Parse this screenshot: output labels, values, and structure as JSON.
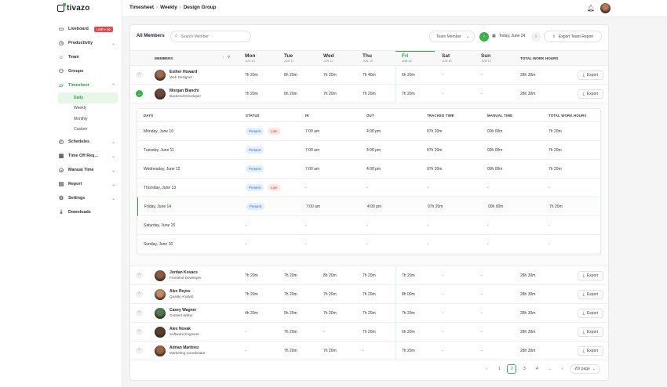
{
  "app": {
    "name": "tivazo"
  },
  "breadcrumb": [
    "Timesheet",
    "Weekly",
    "Design Group"
  ],
  "sidebar": {
    "items": [
      {
        "label": "Liveboard",
        "badge": "LIVE + 20",
        "icon": "folder-icon"
      },
      {
        "label": "Productivity",
        "icon": "stopwatch-icon",
        "chevron": true
      },
      {
        "label": "Team",
        "icon": "users-icon"
      },
      {
        "label": "Groups",
        "icon": "group-icon"
      },
      {
        "label": "Timesheet",
        "icon": "folder-open-icon",
        "chevron": true,
        "active": true
      },
      {
        "label": "Schedules",
        "icon": "clock-icon",
        "chevron": true
      },
      {
        "label": "Time Off Req...",
        "icon": "calendar-icon",
        "chevron": true
      },
      {
        "label": "Manual Time",
        "icon": "clock-edit-icon",
        "chevron": true
      },
      {
        "label": "Report",
        "icon": "report-icon",
        "chevron": true
      },
      {
        "label": "Settings",
        "icon": "gear-icon",
        "chevron": true
      },
      {
        "label": "Downloads",
        "icon": "download-icon"
      }
    ],
    "timesheet_sub": [
      "Daily",
      "Weekly",
      "Monthly",
      "Custom"
    ],
    "active_sub": "Daily"
  },
  "toolbar": {
    "title": "All Members",
    "search_placeholder": "Search Member",
    "team_select": "Team Member",
    "date_range": "Today, June 24",
    "export_team": "Export Team Report"
  },
  "table": {
    "members_header": "MEMBERS",
    "total_header": "TOTAL WORK HOURS",
    "days": [
      {
        "day": "Mon",
        "date": "JUN 10"
      },
      {
        "day": "Tue",
        "date": "JUN 11"
      },
      {
        "day": "Wed",
        "date": "JUN 12"
      },
      {
        "day": "Thu",
        "date": "JUN 13"
      },
      {
        "day": "Fri",
        "date": "JUN 14",
        "active": true
      },
      {
        "day": "Sat",
        "date": "JUN 15"
      },
      {
        "day": "Sun",
        "date": "JUN 16"
      }
    ],
    "export_label": "Export",
    "rows_top": [
      {
        "name": "Esther Howard",
        "role": "Web Designer",
        "hours": [
          "7h 20m",
          "8h 20m",
          "7h 20m",
          "7h 40m",
          "6h 20m",
          "-",
          "-"
        ],
        "total": "28h 30m",
        "open": false,
        "avatar": "#a0694a"
      },
      {
        "name": "Morgan Bianchi",
        "role": "Backend Developer",
        "hours": [
          "7h 20m",
          "6h 20m",
          "7h 20m",
          "7h 20m",
          "7h 20m",
          "-",
          "-"
        ],
        "total": "28h 30m",
        "open": true,
        "avatar": "#6b4a3a"
      }
    ],
    "rows_bottom": [
      {
        "name": "Jordan Kovacs",
        "role": "Frontend Developer",
        "hours": [
          "7h 20m",
          "7h 20m",
          "8h 20m",
          "7h 20m",
          "7h 20m",
          "-",
          "-"
        ],
        "total": "28h 30m",
        "avatar": "#8a5b3f"
      },
      {
        "name": "Alex Reyes",
        "role": "Quality Analyst",
        "hours": [
          "7h 20m",
          "7h 20m",
          "7h 20m",
          "7h 20m",
          "8h 00m",
          "-",
          "-"
        ],
        "total": "28h 30m",
        "avatar": "#c08a62"
      },
      {
        "name": "Casey Wagner",
        "role": "Content Writer",
        "hours": [
          "4h 20m",
          "5h 20m",
          "7h 20m",
          "7h 20m",
          "7h 20m",
          "-",
          "-"
        ],
        "total": "28h 30m",
        "avatar": "#4e7b52"
      },
      {
        "name": "Alex Novak",
        "role": "Software Engineer",
        "hours": [
          "-",
          "7h 20m",
          "-",
          "7h 20m",
          "6h 20m",
          "-",
          "-"
        ],
        "total": "28h 30m",
        "avatar": "#5b3d30"
      },
      {
        "name": "Adrian Martinez",
        "role": "Marketing Coordinator",
        "hours": [
          "-",
          "7h 20m",
          "7h 20m",
          "-",
          "7h 20m",
          "-",
          "-"
        ],
        "total": "28h 30m",
        "avatar": "#9b6242"
      }
    ]
  },
  "detail": {
    "headers": [
      "DAYS",
      "STATUS",
      "IN",
      "OUT",
      "TRACKED TIME",
      "MANUAL TIME",
      "TOTAL WORK HOURS"
    ],
    "rows": [
      {
        "day": "Monday, June 10",
        "status": [
          "Present",
          "Late"
        ],
        "in": "7:00 am",
        "out": "4:00 pm",
        "tracked": "07h 20m",
        "manual": "00h 00m",
        "total": "7h 20m"
      },
      {
        "day": "Tuesday, June 11",
        "status": [
          "Present"
        ],
        "in": "7:00 am",
        "out": "4:00 pm",
        "tracked": "07h 20m",
        "manual": "00h 00m",
        "total": "7h 20m"
      },
      {
        "day": "Wednesday, June 12",
        "status": [
          "Present"
        ],
        "in": "7:00 am",
        "out": "4:00 pm",
        "tracked": "07h 20m",
        "manual": "00h 00m",
        "total": "7h 20m"
      },
      {
        "day": "Thursday, June 13",
        "status": [
          "Present",
          "Late"
        ],
        "in": "-",
        "out": "-",
        "tracked": "-",
        "manual": "-",
        "total": "-"
      },
      {
        "day": "Friday, June 14",
        "status": [
          "Present"
        ],
        "in": "7:00 am",
        "out": "4:00 pm",
        "tracked": "07h 20m",
        "manual": "00h 00m",
        "total": "7h 20m",
        "highlight": true
      },
      {
        "day": "Saturday, June 15",
        "status": [],
        "in": "-",
        "out": "-",
        "tracked": "-",
        "manual": "-",
        "total": "-"
      },
      {
        "day": "Sunday, June 16",
        "status": [],
        "in": "-",
        "out": "-",
        "tracked": "-",
        "manual": "-",
        "total": "-"
      }
    ]
  },
  "pagination": {
    "pages": [
      "1",
      "2",
      "3",
      "4",
      "..."
    ],
    "active": "2",
    "per_page": "20/ page"
  },
  "colors": {
    "accent": "#38b24a",
    "late": "#d64545",
    "present": "#2c6ecb"
  }
}
